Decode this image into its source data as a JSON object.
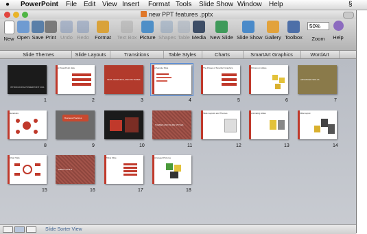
{
  "menubar": {
    "app_name": "PowerPoint",
    "items": [
      "File",
      "Edit",
      "View",
      "Insert",
      "Format",
      "Tools",
      "Slide Show",
      "Window",
      "Help"
    ]
  },
  "window": {
    "title": "new PPT features .pptx"
  },
  "toolbar": {
    "buttons": [
      "New",
      "Open",
      "Save",
      "Print",
      "Undo",
      "Redo",
      "Format",
      "Text Box",
      "Picture",
      "Shapes",
      "Table",
      "Media",
      "New Slide",
      "Slide Show",
      "Gallery",
      "Toolbox",
      "Zoom",
      "Help"
    ],
    "zoom_value": "50%"
  },
  "ribbon": {
    "tabs": [
      "Slide Themes",
      "Slide Layouts",
      "Transitions",
      "Table Styles",
      "Charts",
      "SmartArt Graphics",
      "WordArt"
    ]
  },
  "slides": [
    {
      "number": "1",
      "title": "",
      "body": "INTRODUCING POWERPOINT 2011"
    },
    {
      "number": "2",
      "title": "A PowerPoint slide",
      "body": ""
    },
    {
      "number": "3",
      "title": "",
      "body": "TEXT, GRAPHICS, AND PICTURES"
    },
    {
      "number": "4",
      "title": "A Sample Slide",
      "body": ""
    },
    {
      "number": "5",
      "title": "The Power of SmartArt Graphics",
      "body": ""
    },
    {
      "number": "6",
      "title": "Pictures in slides",
      "body": ""
    },
    {
      "number": "7",
      "title": "",
      "body": "ADVANCED SKILLS"
    },
    {
      "number": "8",
      "title": "Handouts",
      "body": ""
    },
    {
      "number": "9",
      "title": "",
      "body": "Business Practices"
    },
    {
      "number": "10",
      "title": "",
      "body": ""
    },
    {
      "number": "11",
      "title": "",
      "body": "THEMES AND SLIDE STYLES"
    },
    {
      "number": "12",
      "title": "Slide Layouts and Themes",
      "body": ""
    },
    {
      "number": "13",
      "title": "Animating slides",
      "body": ""
    },
    {
      "number": "14",
      "title": "Slide layout",
      "body": ""
    },
    {
      "number": "15",
      "title": "Chart Slide",
      "body": ""
    },
    {
      "number": "16",
      "title": "",
      "body": "MEDIA TOOLS"
    },
    {
      "number": "17",
      "title": "Table Slide",
      "body": ""
    },
    {
      "number": "18",
      "title": "Arranged Pictures",
      "body": ""
    }
  ],
  "status": {
    "view_label": "Slide Sorter View"
  },
  "colors": {
    "selection": "#5b8ed6",
    "accent_red": "#b23a2c"
  }
}
